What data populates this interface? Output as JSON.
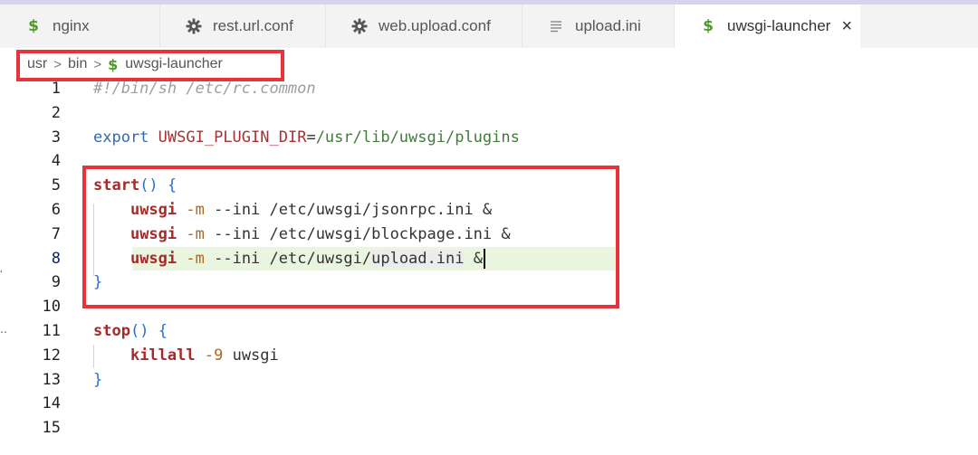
{
  "tabs": [
    {
      "label": "nginx",
      "icon": "dollar-icon"
    },
    {
      "label": "rest.url.conf",
      "icon": "gear-icon"
    },
    {
      "label": "web.upload.conf",
      "icon": "gear-icon"
    },
    {
      "label": "upload.ini",
      "icon": "lines-icon"
    },
    {
      "label": "uwsgi-launcher",
      "icon": "dollar-icon",
      "active": true,
      "close": "×"
    }
  ],
  "breadcrumb": {
    "parts": [
      "usr",
      "bin",
      "uwsgi-launcher"
    ],
    "separator": ">"
  },
  "editor": {
    "current_line": 8,
    "lines": [
      {
        "n": "1",
        "tokens": [
          {
            "t": "#!/bin/sh /etc/rc.common",
            "c": "c-com"
          }
        ]
      },
      {
        "n": "2",
        "tokens": []
      },
      {
        "n": "3",
        "tokens": [
          {
            "t": "export",
            "c": "c-kw"
          },
          {
            "t": " "
          },
          {
            "t": "UWSGI_PLUGIN_DIR",
            "c": "c-var"
          },
          {
            "t": "="
          },
          {
            "t": "/usr/lib/uwsgi/plugins",
            "c": "c-str"
          }
        ]
      },
      {
        "n": "4",
        "tokens": []
      },
      {
        "n": "5",
        "tokens": [
          {
            "t": "start",
            "c": "c-fn"
          },
          {
            "t": "()",
            "c": "c-brc"
          },
          {
            "t": " "
          },
          {
            "t": "{",
            "c": "c-brc"
          }
        ]
      },
      {
        "n": "6",
        "tokens": [
          {
            "t": "    "
          },
          {
            "t": "uwsgi",
            "c": "c-fn"
          },
          {
            "t": " "
          },
          {
            "t": "-m",
            "c": "c-flag"
          },
          {
            "t": " --ini /etc/uwsgi/jsonrpc.ini &",
            "c": "c-path"
          }
        ]
      },
      {
        "n": "7",
        "tokens": [
          {
            "t": "    "
          },
          {
            "t": "uwsgi",
            "c": "c-fn"
          },
          {
            "t": " "
          },
          {
            "t": "-m",
            "c": "c-flag"
          },
          {
            "t": " --ini /etc/uwsgi/blockpage.ini &",
            "c": "c-path"
          }
        ]
      },
      {
        "n": "8",
        "tokens": [
          {
            "t": "    "
          },
          {
            "t": "uwsgi",
            "c": "c-fn"
          },
          {
            "t": " "
          },
          {
            "t": "-m",
            "c": "c-flag"
          },
          {
            "t": " --ini /etc/uwsgi/",
            "c": "c-path"
          },
          {
            "t": "upload.ini",
            "c": "sel-word"
          },
          {
            "t": " &",
            "c": "c-path"
          }
        ],
        "cursor": true
      },
      {
        "n": "9",
        "tokens": [
          {
            "t": "}",
            "c": "c-brc"
          }
        ]
      },
      {
        "n": "10",
        "tokens": []
      },
      {
        "n": "11",
        "tokens": [
          {
            "t": "stop",
            "c": "c-fn"
          },
          {
            "t": "()",
            "c": "c-brc"
          },
          {
            "t": " "
          },
          {
            "t": "{",
            "c": "c-brc"
          }
        ]
      },
      {
        "n": "12",
        "tokens": [
          {
            "t": "    "
          },
          {
            "t": "killall",
            "c": "c-fn"
          },
          {
            "t": " "
          },
          {
            "t": "-9",
            "c": "c-flag"
          },
          {
            "t": " uwsgi",
            "c": "c-path"
          }
        ]
      },
      {
        "n": "13",
        "tokens": [
          {
            "t": "}",
            "c": "c-brc"
          }
        ]
      },
      {
        "n": "14",
        "tokens": []
      },
      {
        "n": "15",
        "tokens": []
      }
    ]
  },
  "colors": {
    "highlight_box": "#e8333c",
    "current_line_bg": "#e9f5df",
    "dollar_icon": "#4c9a2a"
  }
}
